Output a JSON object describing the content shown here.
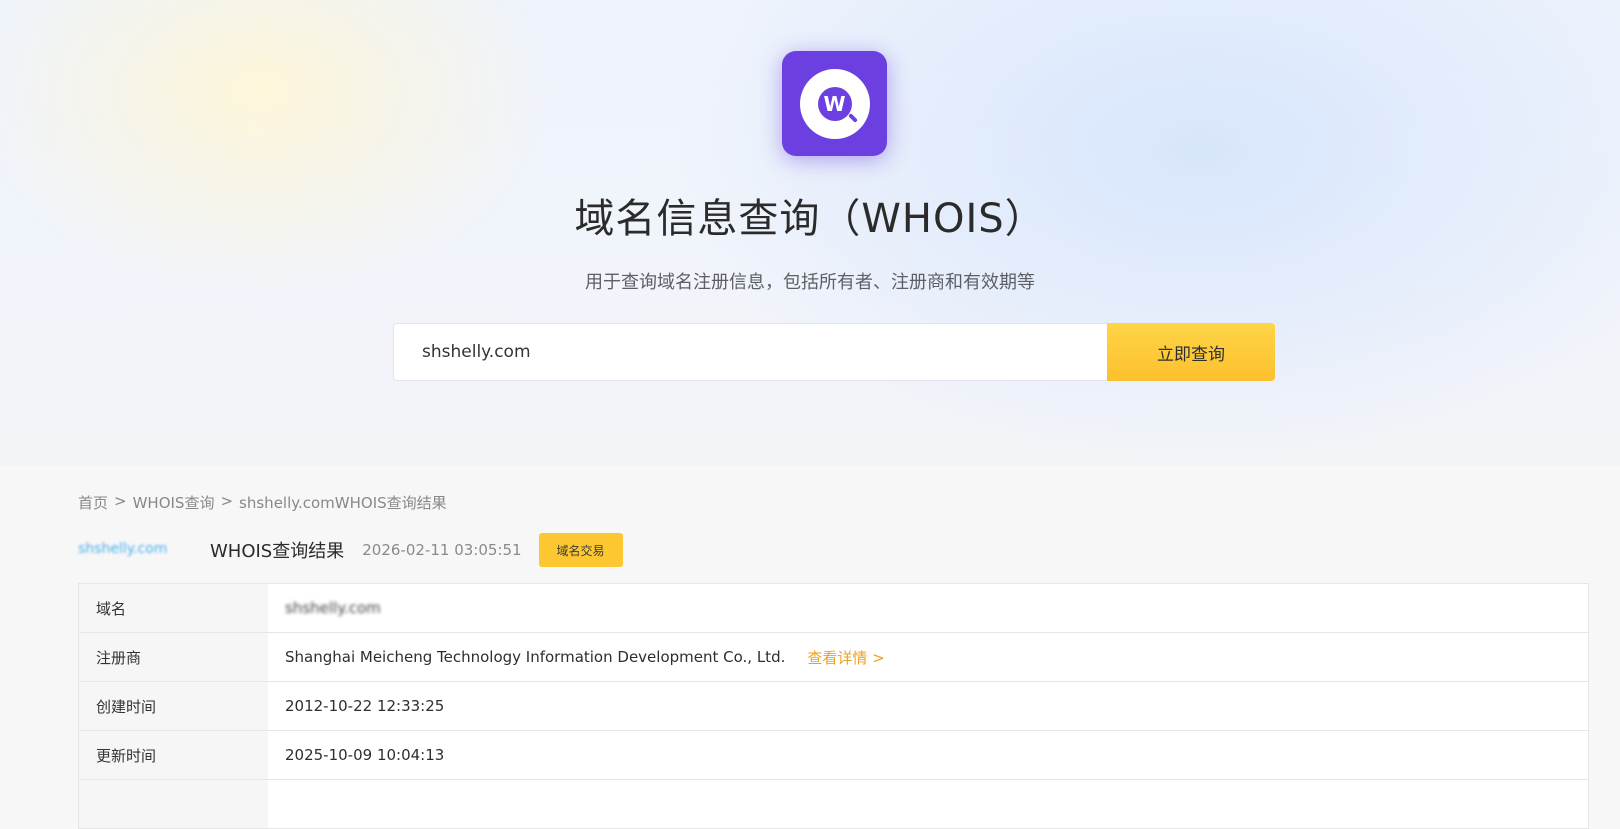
{
  "hero": {
    "logo_letter": "W",
    "title": "域名信息查询（WHOIS）",
    "subtitle": "用于查询域名注册信息，包括所有者、注册商和有效期等",
    "search_value": "shshelly.com",
    "search_button": "立即查询",
    "accent_color": "#6b3fe0",
    "button_color": "#fcc730"
  },
  "breadcrumb": {
    "home": "首页",
    "sep1": ">",
    "whois": "WHOIS查询",
    "sep2": ">",
    "current": "shshelly.comWHOIS查询结果"
  },
  "result": {
    "domain_logo_text": "shshelly.com",
    "title": "WHOIS查询结果",
    "time": "2026-02-11 03:05:51",
    "trade_button": "域名交易"
  },
  "table": {
    "rows": [
      {
        "key": "域名",
        "value": "shshelly.com"
      },
      {
        "key": "注册商",
        "value": "Shanghai Meicheng Technology Information Development Co., Ltd.",
        "link": "查看详情 >"
      },
      {
        "key": "创建时间",
        "value": "2012-10-22 12:33:25"
      },
      {
        "key": "更新时间",
        "value": "2025-10-09 10:04:13"
      }
    ]
  }
}
